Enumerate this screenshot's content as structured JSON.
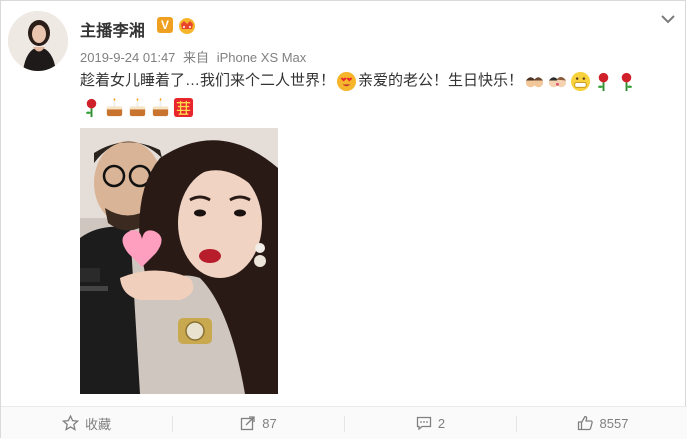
{
  "post": {
    "username": "主播李湘",
    "verified_badge": "V",
    "timestamp": "2019-9-24 01:47",
    "source_prefix": "来自",
    "source_device": "iPhone XS Max",
    "text_part1": "趁着女儿睡着了…我们来个二人世界！",
    "text_part2": "亲爱的老公！生日快乐！"
  },
  "icons": {
    "more": "chevron-down-icon",
    "emoji_1": "heart-eyes-emoji",
    "emoji_couple": "couple-emoji",
    "emoji_grin": "grin-emoji",
    "emoji_rose": "rose-emoji",
    "emoji_cake": "cake-emoji",
    "emoji_double_happiness": "double-happiness-emoji"
  },
  "footer": {
    "favorite_label": "收藏",
    "repost_count": "87",
    "comment_count": "2",
    "like_count": "8557"
  },
  "colors": {
    "text": "#333333",
    "meta": "#808080",
    "badge": "#f0a020",
    "rose": "#d0202a"
  }
}
